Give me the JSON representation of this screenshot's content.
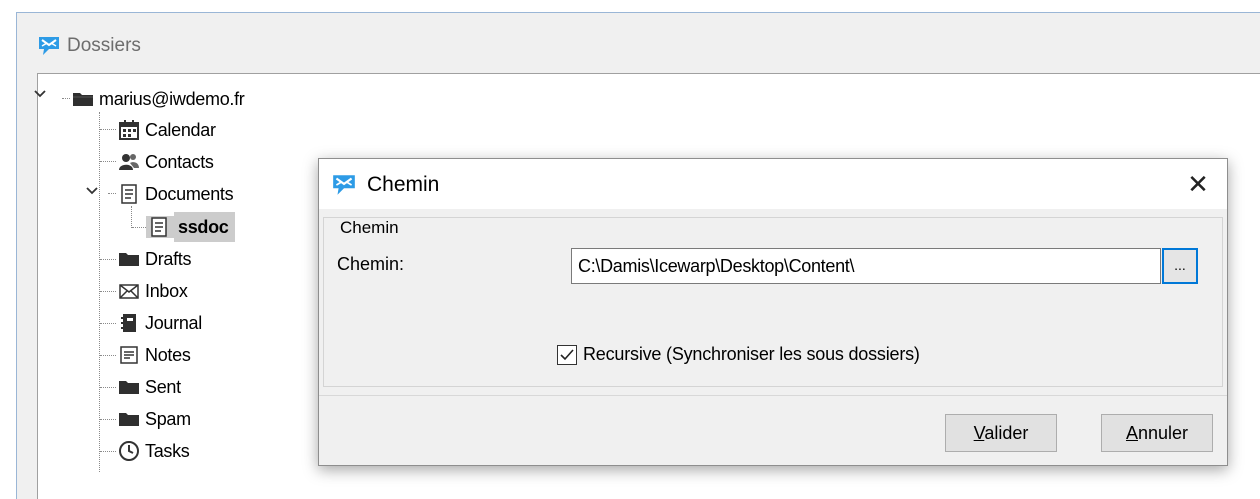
{
  "outer_window": {
    "title": "Dossiers"
  },
  "tree": {
    "root": {
      "label": "marius@iwdemo.fr",
      "expanded": true
    },
    "items": [
      {
        "label": "Calendar",
        "icon": "calendar-icon"
      },
      {
        "label": "Contacts",
        "icon": "contacts-icon"
      },
      {
        "label": "Documents",
        "icon": "document-icon",
        "expanded": true
      },
      {
        "label": "ssdoc",
        "icon": "document-icon",
        "selected": true
      },
      {
        "label": "Drafts",
        "icon": "folder-icon"
      },
      {
        "label": "Inbox",
        "icon": "envelope-icon"
      },
      {
        "label": "Journal",
        "icon": "journal-icon"
      },
      {
        "label": "Notes",
        "icon": "note-icon"
      },
      {
        "label": "Sent",
        "icon": "folder-icon"
      },
      {
        "label": "Spam",
        "icon": "folder-icon"
      },
      {
        "label": "Tasks",
        "icon": "clock-icon"
      }
    ]
  },
  "dialog": {
    "title": "Chemin",
    "close_glyph": "✕",
    "group_label": "Chemin",
    "field_label": "Chemin:",
    "field_value": "C:\\Damis\\Icewarp\\Desktop\\Content\\",
    "browse_label": "...",
    "recursive_label": "Recursive (Synchroniser les sous dossiers)",
    "recursive_checked": true,
    "ok_accel": "V",
    "ok_rest": "alider",
    "cancel_accel": "A",
    "cancel_rest": "nnuler"
  },
  "colors": {
    "accent": "#0078d7",
    "logo_blue": "#2d9be6",
    "selection": "#cccccc",
    "window_bg": "#f0f0f0"
  }
}
